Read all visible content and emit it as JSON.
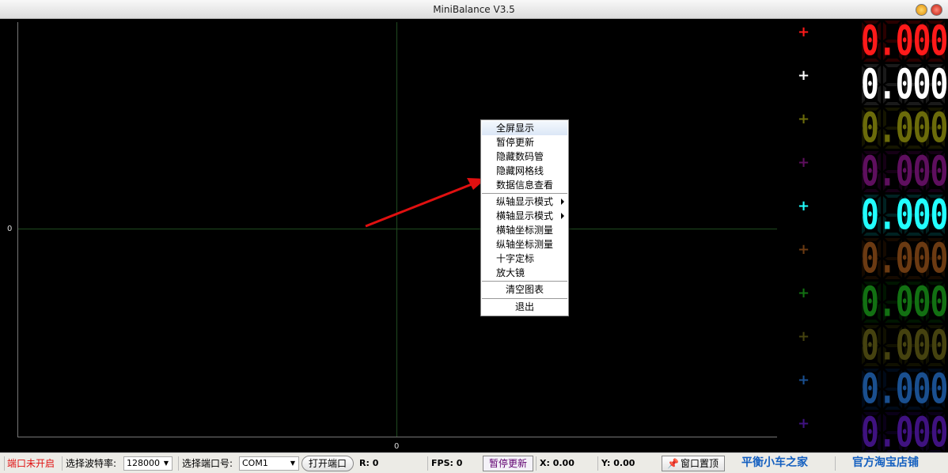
{
  "window": {
    "title": "MiniBalance V3.5"
  },
  "plot": {
    "y_axis_zero": "0",
    "x_axis_zero": "0"
  },
  "context_menu": {
    "items": [
      {
        "label": "全屏显示",
        "highlighted": true
      },
      {
        "label": "暂停更新"
      },
      {
        "label": "隐藏数码管"
      },
      {
        "label": "隐藏网格线"
      },
      {
        "label": "数据信息查看"
      },
      {
        "label": "纵轴显示模式",
        "submenu": true
      },
      {
        "label": "横轴显示模式",
        "submenu": true
      },
      {
        "label": "横轴坐标测量"
      },
      {
        "label": "纵轴坐标测量"
      },
      {
        "label": "十字定标"
      },
      {
        "label": "放大镜"
      },
      {
        "label": "清空图表"
      },
      {
        "label": "退出"
      }
    ]
  },
  "channels": [
    {
      "value": "0.000",
      "color": "#ff1a1a",
      "dim": "#2a0000"
    },
    {
      "value": "0.000",
      "color": "#ffffff",
      "dim": "#1a1a1a"
    },
    {
      "value": "0.000",
      "color": "#6b6b0a",
      "dim": "#151500"
    },
    {
      "value": "0.000",
      "color": "#5e0f5e",
      "dim": "#150015"
    },
    {
      "value": "0.000",
      "color": "#22ffff",
      "dim": "#002222"
    },
    {
      "value": "0.000",
      "color": "#6b3a12",
      "dim": "#150a00"
    },
    {
      "value": "0.000",
      "color": "#127012",
      "dim": "#001500"
    },
    {
      "value": "0.000",
      "color": "#45420f",
      "dim": "#101000"
    },
    {
      "value": "0.000",
      "color": "#1a4f8f",
      "dim": "#000a18"
    },
    {
      "value": "0.000",
      "color": "#3f1280",
      "dim": "#0a0018"
    }
  ],
  "status": {
    "port_state": "端口未开启",
    "baud_label": "选择波特率:",
    "baud_value": "128000",
    "port_label": "选择端口号:",
    "port_value": "COM1",
    "open_port": "打开端口",
    "r": "R: 0",
    "fps": "FPS: 0",
    "pause": "暂停更新",
    "x": "X: 0.00",
    "y": "Y: 0.00",
    "pin": "窗口置顶",
    "link1": "平衡小车之家",
    "link2": "官方淘宝店铺"
  }
}
